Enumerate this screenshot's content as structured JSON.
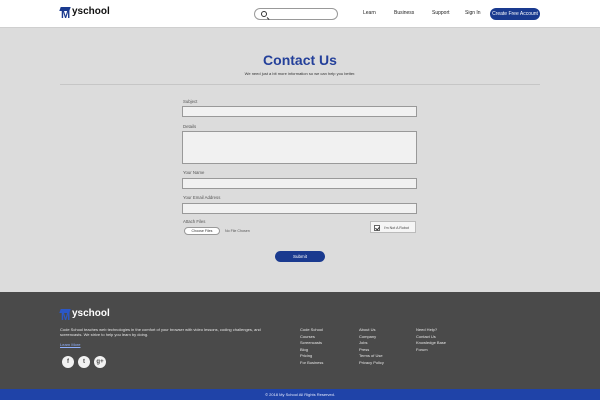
{
  "header": {
    "logo_text": "yschool",
    "logo_mark": "M",
    "nav": [
      "Learn",
      "Business",
      "Support",
      "Sign In"
    ],
    "cta": "Create Free Account"
  },
  "contact": {
    "title": "Contact Us",
    "subtitle": "We need just a bit more information so we can help you better.",
    "fields": {
      "subject": {
        "label": "Subject",
        "value": ""
      },
      "details": {
        "label": "Details",
        "value": ""
      },
      "name": {
        "label": "Your Name",
        "value": ""
      },
      "email": {
        "label": "Your Email Address",
        "value": ""
      }
    },
    "attach_label": "Attach Files",
    "choose_files": "Choose Files",
    "no_file": "No File Chosen",
    "captcha": "I'm Not A Robot",
    "submit": "Submit"
  },
  "footer": {
    "logo_text": "yschool",
    "logo_mark": "M",
    "about": "Code School teaches web technologies in the comfort of your browser with video lessons, coding challenges, and screencasts. We strive to help you learn by doing.",
    "learn_more": "Learn More",
    "social": [
      "facebook-icon",
      "twitter-icon",
      "googleplus-icon"
    ],
    "col1": [
      "Code School",
      "Courses",
      "Screencasts",
      "Blog",
      "Pricing",
      "For Business"
    ],
    "col2": [
      "About Us",
      "Company",
      "Jobs",
      "Press",
      "Terms of Use",
      "Privacy Policy"
    ],
    "col3": [
      "Need Help?",
      "Contact Us",
      "Knowledge Base",
      "Forum"
    ],
    "copyright": "© 2018 My School All Rights Reserved."
  },
  "colors": {
    "brand": "#1a3a8f",
    "title": "#24409a",
    "footer_bg": "#4a4a4a",
    "copyright_bg": "#1f43a8"
  }
}
